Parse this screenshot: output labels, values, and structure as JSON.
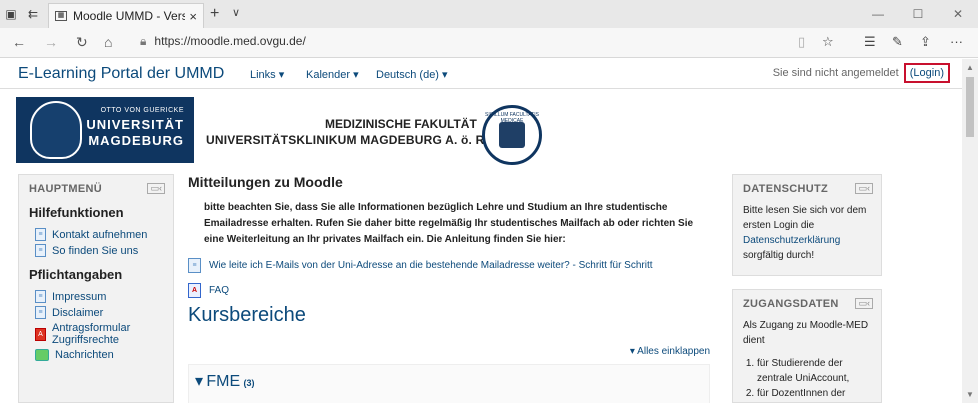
{
  "browser": {
    "tab_title": "Moodle UMMD - Versic",
    "tab_close": "×",
    "new_tab": "+",
    "tab_dropdown": "∨",
    "url": "https://moodle.med.ovgu.de/",
    "win_min": "—",
    "win_max": "☐",
    "win_close": "✕"
  },
  "topnav": {
    "brand": "E-Learning Portal der UMMD",
    "links": "Links ▾",
    "calendar": "Kalender ▾",
    "language": "Deutsch (de) ▾",
    "not_logged_in": "Sie sind nicht angemeldet",
    "login": "(Login)"
  },
  "header": {
    "uni_small": "OTTO VON GUERICKE",
    "uni_line1": "UNIVERSITÄT",
    "uni_line2": "MAGDEBURG",
    "faculty_line1": "MEDIZINISCHE FAKULTÄT",
    "faculty_line2": "UNIVERSITÄTSKLINIKUM MAGDEBURG A. ö. R.",
    "seal_text": "SIGILLUM FACULTATIS MEDICAE"
  },
  "left_block": {
    "heading": "HAUPTMENÜ",
    "section1": "Hilfefunktionen",
    "items1": [
      "Kontakt aufnehmen",
      "So finden Sie uns"
    ],
    "section2": "Pflichtangaben",
    "items2": [
      "Impressum",
      "Disclaimer",
      "Antragsformular Zugriffsrechte",
      "Nachrichten"
    ]
  },
  "main": {
    "title": "Mitteilungen zu Moodle",
    "paragraph": "bitte beachten Sie, dass Sie alle Informationen bezüglich Lehre und Studium an Ihre studentische Emailadresse erhalten. Rufen Sie daher bitte regelmäßig Ihr studentisches Mailfach ab oder richten Sie eine Weiterleitung an Ihr privates Mailfach ein. Die Anleitung finden Sie hier:",
    "link1": "Wie leite ich E-Mails von der Uni-Adresse an die bestehende Mailadresse weiter? - Schritt für Schritt",
    "link2": "FAQ",
    "courses_heading": "Kursbereiche",
    "collapse_all": "Alles einklappen",
    "category": "FME",
    "category_count": "(3)"
  },
  "right_blocks": {
    "privacy_heading": "DATENSCHUTZ",
    "privacy_text_pre": "Bitte lesen Sie sich vor dem ersten Login die",
    "privacy_link": "Datenschutzerklärung",
    "privacy_text_post": "sorgfältig durch!",
    "access_heading": "ZUGANGSDATEN",
    "access_intro": "Als Zugang zu Moodle-MED dient",
    "access_list": [
      "für Studierende der zentrale UniAccount,",
      "für DozentInnen der"
    ]
  },
  "colors": {
    "link": "#0c4a7b",
    "highlight": "#c8102e",
    "block_bg": "#f2f2f2"
  }
}
